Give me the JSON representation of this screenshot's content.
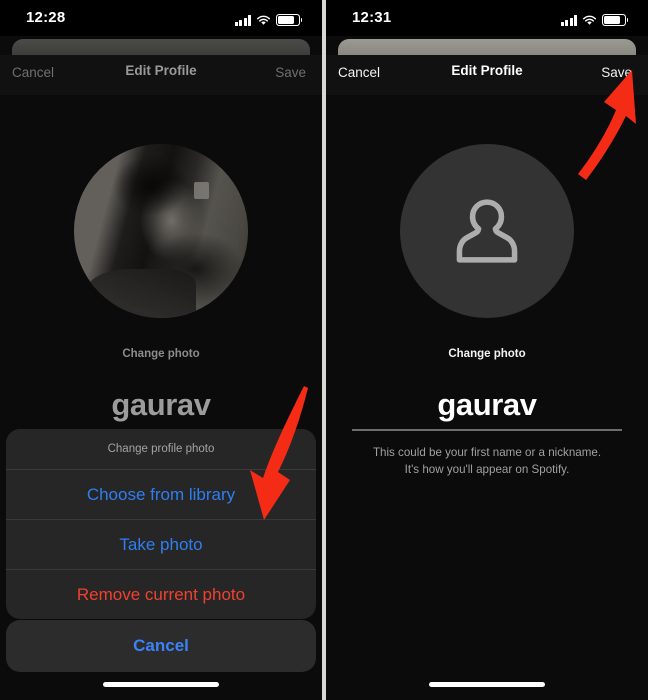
{
  "panels": [
    {
      "id": "left",
      "status": {
        "time": "12:28",
        "signal_icon": "cellular-bars-icon",
        "wifi_icon": "wifi-icon",
        "battery_icon": "battery-icon"
      },
      "nav": {
        "cancel": "Cancel",
        "title": "Edit Profile",
        "save": "Save"
      },
      "avatar": {
        "type": "photo",
        "alt": "user-profile-photo"
      },
      "change_photo": "Change photo",
      "name_value": "gaurav",
      "action_sheet": {
        "title": "Change profile photo",
        "options": [
          {
            "label": "Choose from library",
            "style": "blue"
          },
          {
            "label": "Take photo",
            "style": "blue"
          },
          {
            "label": "Remove current photo",
            "style": "red"
          }
        ],
        "cancel": "Cancel"
      },
      "annotation": {
        "type": "arrow",
        "direction": "down-left",
        "color": "#f42b15",
        "points_at": "Choose from library"
      }
    },
    {
      "id": "right",
      "status": {
        "time": "12:31",
        "signal_icon": "cellular-bars-icon",
        "wifi_icon": "wifi-icon",
        "battery_icon": "battery-icon"
      },
      "nav": {
        "cancel": "Cancel",
        "title": "Edit Profile",
        "save": "Save"
      },
      "avatar": {
        "type": "placeholder",
        "alt": "default-person-avatar-icon"
      },
      "change_photo": "Change photo",
      "name_value": "gaurav",
      "helper_line1": "This could be your first name or a nickname.",
      "helper_line2": "It's how you'll appear on Spotify.",
      "annotation": {
        "type": "arrow",
        "direction": "up-right",
        "color": "#f42b15",
        "points_at": "Save"
      }
    }
  ],
  "colors": {
    "accent_blue": "#2f7ef0",
    "destructive_red": "#f0412f",
    "annotation_red": "#f42b15",
    "sheet_bg": "#262626",
    "panel_bg": "#0b0b0b",
    "avatar_placeholder_bg": "#333333"
  }
}
